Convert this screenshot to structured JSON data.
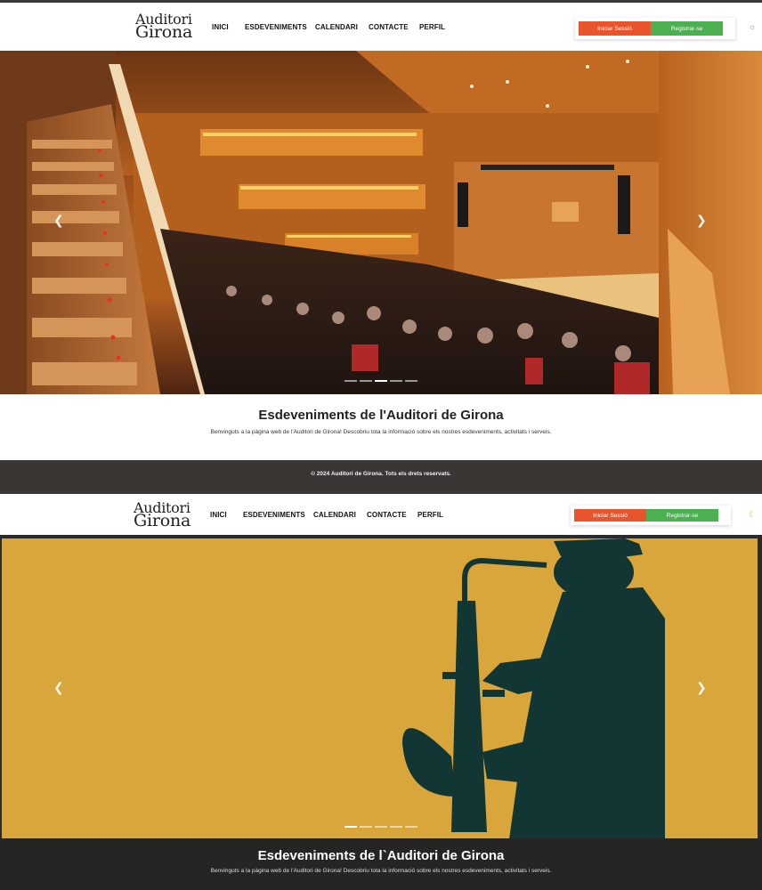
{
  "brand": {
    "line1": "Auditori",
    "line2": "Girona"
  },
  "nav": {
    "items": [
      "INICI",
      "ESDEVENIMENTS",
      "CALENDARI",
      "CONTACTE",
      "PERFIL"
    ]
  },
  "auth": {
    "login_label": "Iniciar Sessió",
    "register_label": "Registrar-se"
  },
  "theme": {
    "light_icon": "sun-icon",
    "dark_icon": "moon-icon"
  },
  "carousel": {
    "prev_icon": "chevron-left-icon",
    "next_icon": "chevron-right-icon",
    "slide_count": 5
  },
  "intro": {
    "title": "Esdeveniments de l'Auditori de Girona",
    "subtitle": "Benvinguts a la pàgina web de l'Auditori de Girona! Descobriu tota la informació sobre els nostres esdeveniments, activitats i serveis."
  },
  "intro_dark": {
    "title": "Esdeveniments de l`Auditori de Girona",
    "subtitle": "Benvinguts a la pàgina web de l'Auditori de Girona! Descobriu tota la informació sobre els nostres esdeveniments, activitats i serveis."
  },
  "footer": {
    "copyright": "© 2024 Auditori de Girona. Tots els drets reservats."
  },
  "colors": {
    "login": "#e8552d",
    "register": "#4caf50",
    "footer_bg": "#3a3634",
    "dark_bg": "#262524",
    "saxophone_bg": "#d8a63a",
    "silhouette": "#123633"
  }
}
